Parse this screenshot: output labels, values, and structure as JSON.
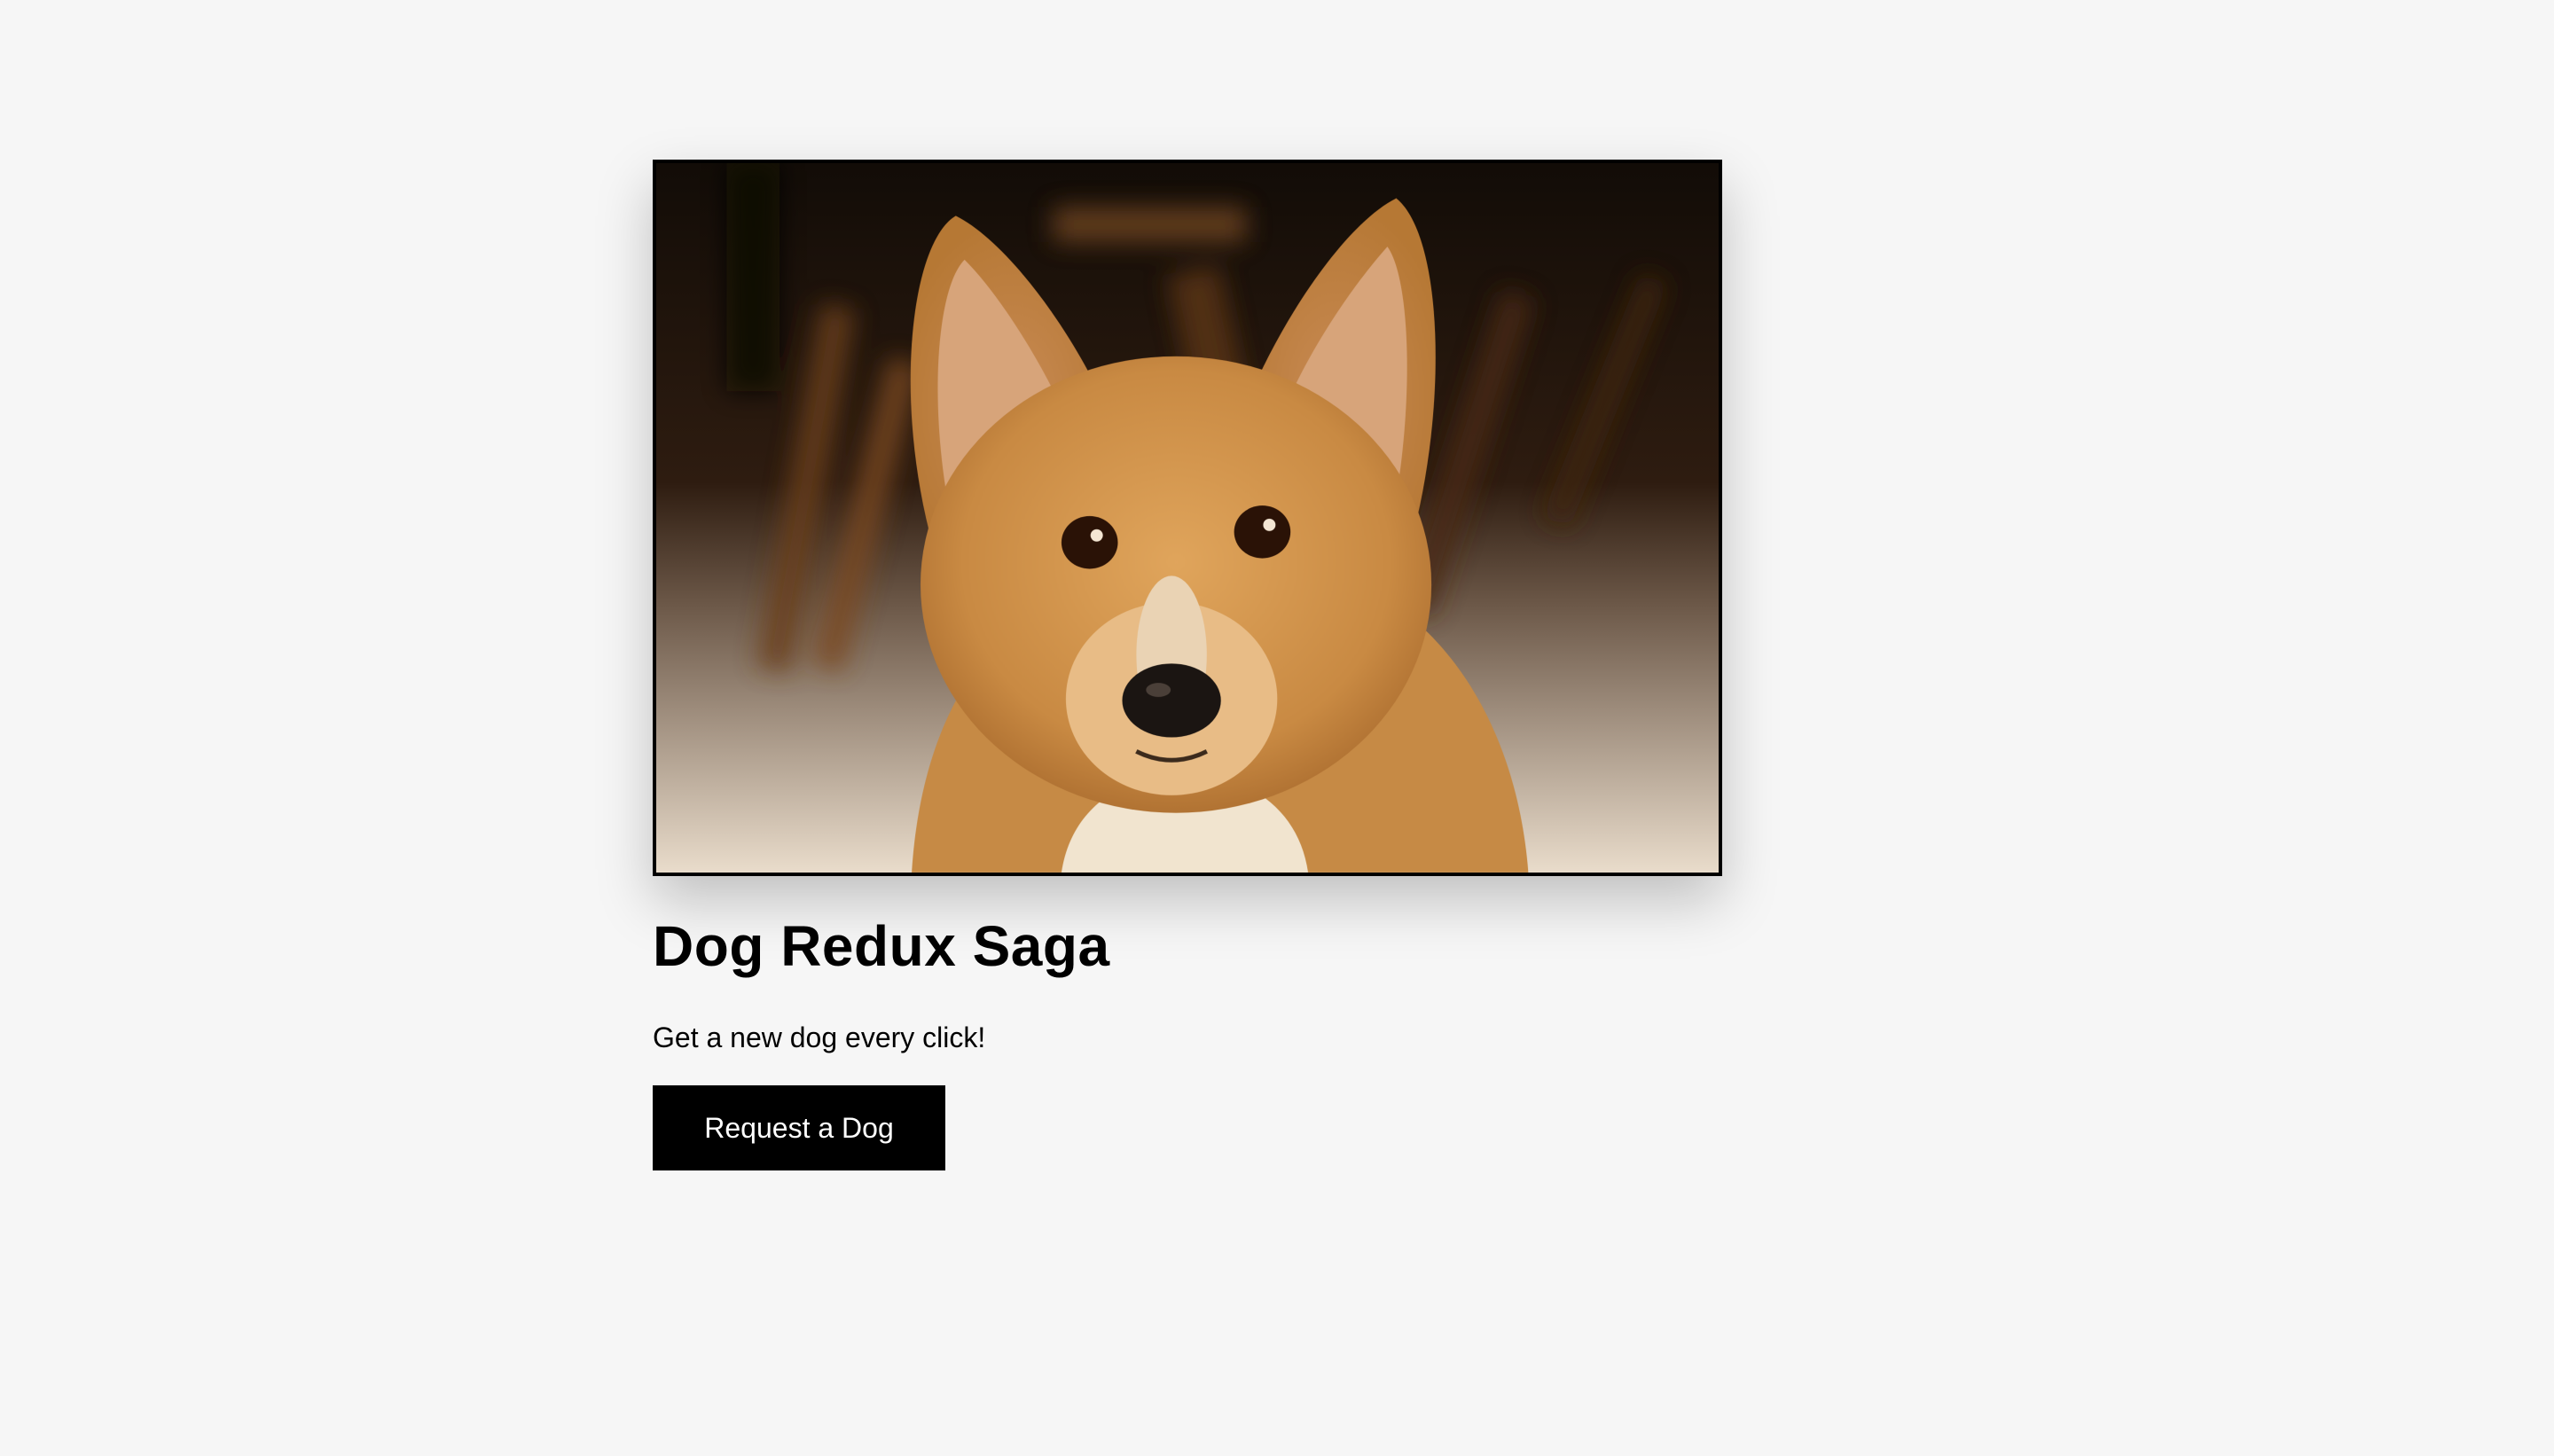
{
  "app": {
    "title": "Dog Redux Saga",
    "subtitle": "Get a new dog every click!",
    "request_button_label": "Request a Dog"
  },
  "image": {
    "subject": "corgi-dog-photo"
  }
}
